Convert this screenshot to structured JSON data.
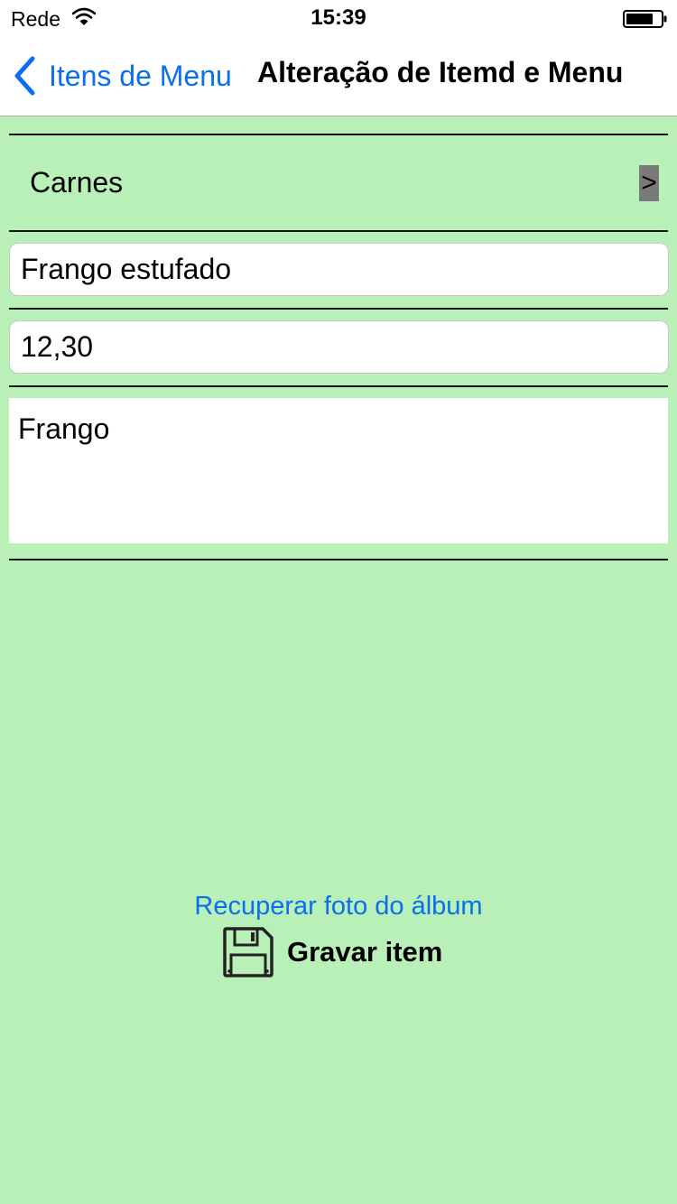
{
  "status_bar": {
    "carrier": "Rede",
    "time": "15:39",
    "wifi_icon": "wifi-icon",
    "battery_icon": "battery-icon"
  },
  "nav": {
    "back_label": "Itens de Menu",
    "back_icon": "chevron-left-icon",
    "title": "Alteração de Itemd e Menu"
  },
  "form": {
    "category": "Carnes",
    "category_chevron": ">",
    "name_value": "Frango estufado",
    "price_value": "12,30",
    "description_value": "Frango"
  },
  "actions": {
    "photo_link": "Recuperar foto do álbum",
    "save_label": "Gravar item",
    "save_icon": "floppy-disk-icon"
  },
  "colors": {
    "background": "#b9f0b8",
    "accent": "#0a6ef0",
    "chevron_box": "#7a7a7a"
  }
}
